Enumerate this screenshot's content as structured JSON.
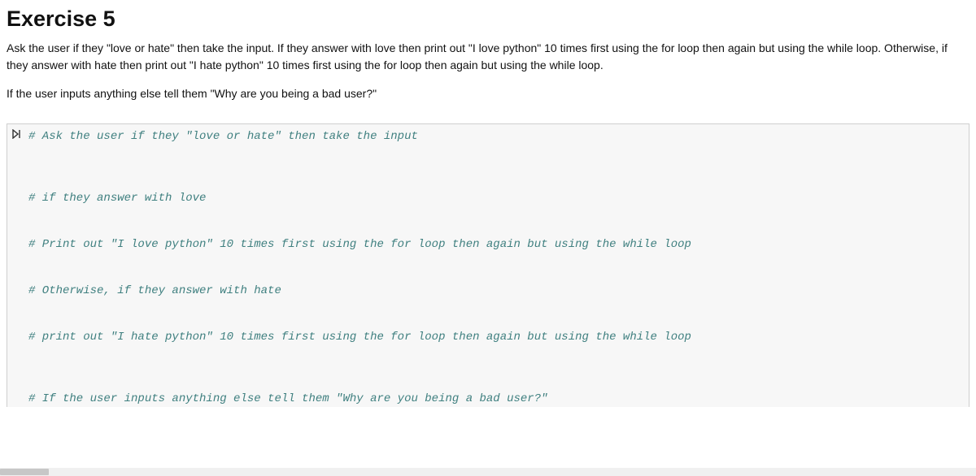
{
  "markdown": {
    "heading": "Exercise 5",
    "p1": "Ask the user if they \"love or hate\" then take the input. If they answer with love then print out \"I love python\" 10 times first using the for loop then again but using the while loop. Otherwise, if they answer with hate then print out \"I hate python\" 10 times first using the for loop then again but using the while loop.",
    "p2": "If the user inputs anything else tell them \"Why are you being a bad user?\""
  },
  "code": {
    "prompt_icon": "⏵⎸",
    "lines": [
      "# Ask the user if they \"love or hate\" then take the input",
      "",
      "",
      "",
      "# if they answer with love",
      "",
      "",
      "# Print out \"I love python\" 10 times first using the for loop then again but using the while loop",
      "",
      "",
      "# Otherwise, if they answer with hate",
      "",
      "",
      "# print out \"I hate python\" 10 times first using the for loop then again but using the while loop",
      "",
      "",
      "",
      "# If the user inputs anything else tell them \"Why are you being a bad user?\""
    ]
  }
}
